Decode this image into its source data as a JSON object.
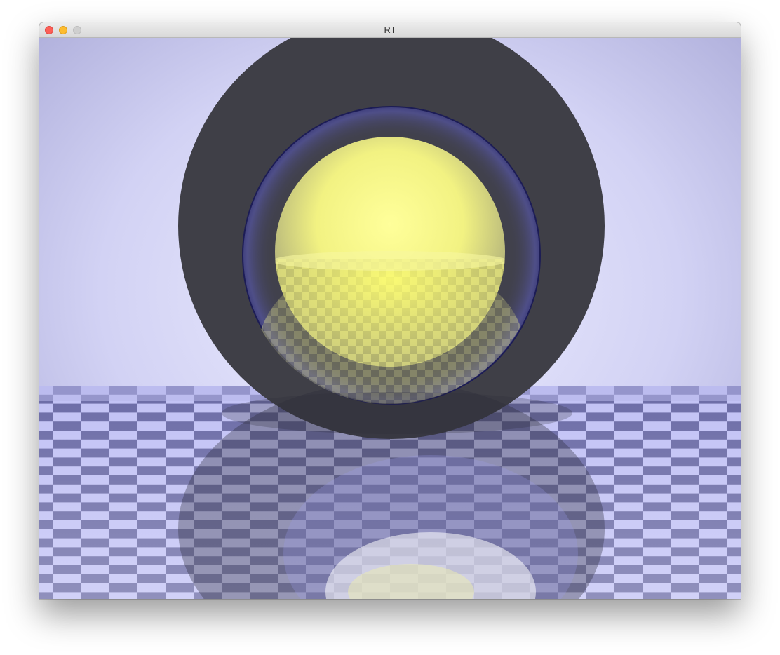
{
  "window": {
    "title": "RT",
    "controls": {
      "close": "close-icon",
      "minimize": "minimize-icon",
      "zoom": "zoom-icon"
    }
  },
  "scene": {
    "description_hidden": true,
    "sky_center_color": "#e6e6ff",
    "sky_edge_color": "#a8a8d6",
    "large_sphere_color": "#3f3f47",
    "glass_sphere_tint": "#5454a6",
    "inner_sphere_color": "#fbfb88",
    "checker_light": "#bdbdf2",
    "checker_dark": "#6f6fa8"
  }
}
